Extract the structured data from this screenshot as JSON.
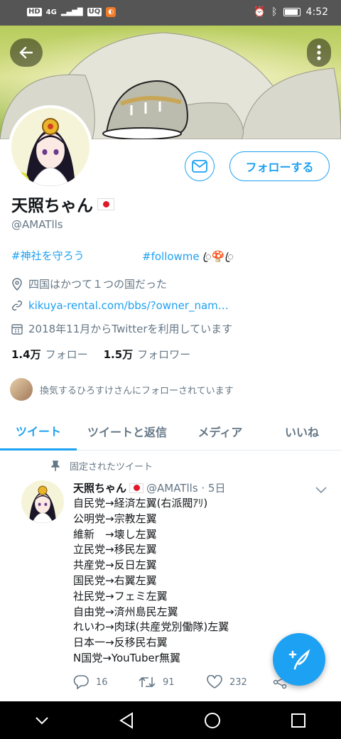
{
  "status_bar": {
    "left_badges": [
      "HD",
      "4G",
      "UQ"
    ],
    "time": "4:52"
  },
  "profile": {
    "display_name": "天照ちゃん",
    "handle": "@AMATlls",
    "bio_tag_1": "#神社を守ろう",
    "bio_tag_2": "#followme",
    "location": "四国はかつて１つの国だった",
    "website": "kikuya-rental.com/bbs/?owner_nam…",
    "joined": "2018年11月からTwitterを利用しています",
    "following_count": "1.4万",
    "following_label": "フォロー",
    "followers_count": "1.5万",
    "followers_label": "フォロワー",
    "followed_by": "換気するひろすけさんにフォローされています",
    "follow_button": "フォローする"
  },
  "tabs": [
    {
      "label": "ツイート",
      "active": true
    },
    {
      "label": "ツイートと返信",
      "active": false
    },
    {
      "label": "メディア",
      "active": false
    },
    {
      "label": "いいね",
      "active": false
    }
  ],
  "pinned_tweet": {
    "pinned_label": "固定されたツイート",
    "author_name": "天照ちゃん",
    "author_meta": "@AMATlls · 5日",
    "lines": [
      "自民党→経済左翼(右派閥ｱﾘ)",
      "公明党→宗教左翼",
      "維新　→壊し左翼",
      "立民党→移民左翼",
      "共産党→反日左翼",
      "国民党→右翼左翼",
      "社民党→フェミ左翼",
      "自由党→済州島民左翼",
      "れいわ→肉球(共産党別働隊)左翼",
      "日本一→反移民右翼",
      "N国党→YouTuber無翼"
    ],
    "replies": "16",
    "retweets": "91",
    "likes": "232"
  },
  "colors": {
    "accent": "#1da1f2",
    "muted": "#657786",
    "text": "#14171a"
  },
  "icons": [
    "back-arrow-icon",
    "more-vertical-icon",
    "mail-icon",
    "location-icon",
    "link-icon",
    "calendar-icon",
    "pin-icon",
    "chevron-down-icon",
    "reply-icon",
    "retweet-icon",
    "like-icon",
    "share-icon",
    "compose-icon"
  ]
}
